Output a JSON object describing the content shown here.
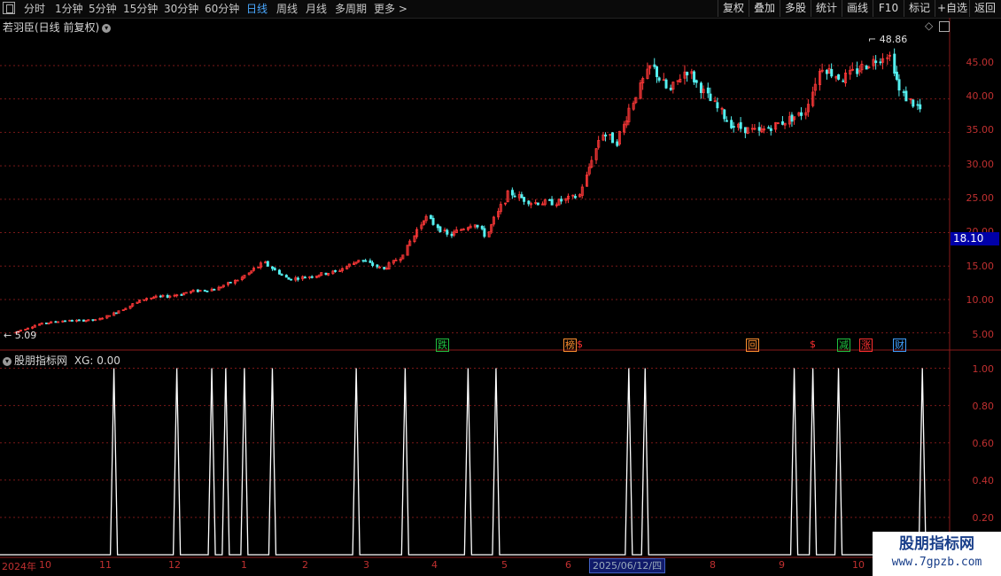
{
  "toolbar": {
    "menu_icon": "window-menu-icon",
    "periods": [
      "分时",
      "1分钟",
      "5分钟",
      "15分钟",
      "30分钟",
      "60分钟",
      "日线",
      "周线",
      "月线",
      "多周期",
      "更多 >"
    ],
    "active_period": "日线",
    "right_buttons": [
      "复权",
      "叠加",
      "多股",
      "统计",
      "画线",
      "F10",
      "标记",
      "+自选",
      "返回"
    ]
  },
  "main_chart": {
    "title": "若羽臣(日线 前复权)",
    "high_label": "48.86",
    "low_label": "5.09",
    "current_price": "18.10",
    "y_ticks": [
      "45.00",
      "40.00",
      "35.00",
      "30.00",
      "25.00",
      "20.00",
      "15.00",
      "10.00",
      "5.00"
    ],
    "badges": [
      {
        "text": "跌",
        "color": "#20c040"
      },
      {
        "text": "榜",
        "color": "#ff9030"
      },
      {
        "text": "$",
        "color": "#ff3030"
      },
      {
        "text": "回",
        "color": "#ff9030"
      },
      {
        "text": "$",
        "color": "#ff3030"
      },
      {
        "text": "减",
        "color": "#20c040"
      },
      {
        "text": "涨",
        "color": "#ff3030"
      },
      {
        "text": "财",
        "color": "#40a0ff"
      }
    ]
  },
  "indicator": {
    "title": "股朋指标网",
    "value_label": "XG: 0.00",
    "y_ticks": [
      "1.00",
      "0.80",
      "0.60",
      "0.40",
      "0.20"
    ]
  },
  "x_axis": {
    "labels": [
      "2024年",
      "10",
      "11",
      "12",
      "1",
      "2",
      "3",
      "4",
      "5",
      "6",
      "8",
      "9",
      "10"
    ],
    "cursor_date": "2025/06/12/四"
  },
  "watermark": {
    "name": "股朋指标网",
    "url": "www.7gpzb.com"
  },
  "colors": {
    "up": "#ff3838",
    "down": "#54f0f0",
    "grid": "#7a1818",
    "signal": "#ffffff"
  },
  "chart_data": [
    {
      "type": "candlestick",
      "title": "若羽臣(日线 前复权)",
      "x_range": [
        "2024-09",
        "2025-10"
      ],
      "ylim": [
        3.5,
        49.5
      ],
      "high": 48.86,
      "low": 5.09,
      "close_path": [
        [
          "2024-09-20",
          5.1
        ],
        [
          "2024-09-30",
          6.3
        ],
        [
          "2024-10-10",
          6.8
        ],
        [
          "2024-10-25",
          6.9
        ],
        [
          "2024-11-05",
          8.5
        ],
        [
          "2024-11-15",
          10.2
        ],
        [
          "2024-11-25",
          10.5
        ],
        [
          "2024-12-05",
          11.2
        ],
        [
          "2024-12-15",
          11.6
        ],
        [
          "2024-12-25",
          13.0
        ],
        [
          "2025-01-05",
          15.5
        ],
        [
          "2025-01-15",
          13.0
        ],
        [
          "2025-01-25",
          13.5
        ],
        [
          "2025-02-05",
          14.2
        ],
        [
          "2025-02-15",
          16.0
        ],
        [
          "2025-02-25",
          14.5
        ],
        [
          "2025-03-05",
          16.5
        ],
        [
          "2025-03-15",
          22.5
        ],
        [
          "2025-03-25",
          19.5
        ],
        [
          "2025-04-05",
          21.5
        ],
        [
          "2025-04-10",
          19.5
        ],
        [
          "2025-04-20",
          26.0
        ],
        [
          "2025-04-30",
          24.5
        ],
        [
          "2025-05-10",
          24.5
        ],
        [
          "2025-05-20",
          25.5
        ],
        [
          "2025-05-30",
          35.0
        ],
        [
          "2025-06-05",
          33.5
        ],
        [
          "2025-06-12",
          39.5
        ],
        [
          "2025-06-20",
          45.0
        ],
        [
          "2025-06-28",
          41.0
        ],
        [
          "2025-07-05",
          44.5
        ],
        [
          "2025-07-15",
          40.0
        ],
        [
          "2025-07-25",
          36.0
        ],
        [
          "2025-08-05",
          35.0
        ],
        [
          "2025-08-15",
          36.5
        ],
        [
          "2025-08-25",
          38.0
        ],
        [
          "2025-09-01",
          45.0
        ],
        [
          "2025-09-10",
          43.0
        ],
        [
          "2025-09-20",
          45.0
        ],
        [
          "2025-09-30",
          47.0
        ],
        [
          "2025-10-05",
          41.0
        ],
        [
          "2025-10-15",
          38.0
        ]
      ]
    },
    {
      "type": "line",
      "series": [
        {
          "name": "XG",
          "values": [
            0,
            1
          ]
        }
      ],
      "ylim": [
        0,
        1.05
      ],
      "signal_dates": [
        "2024-11-01",
        "2024-11-28",
        "2024-12-13",
        "2024-12-19",
        "2024-12-27",
        "2025-01-08",
        "2025-02-13",
        "2025-03-06",
        "2025-04-02",
        "2025-04-14",
        "2025-06-10",
        "2025-06-17",
        "2025-08-20",
        "2025-08-28",
        "2025-09-08",
        "2025-10-14"
      ]
    }
  ]
}
